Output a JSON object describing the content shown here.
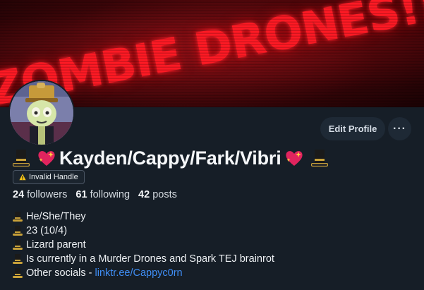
{
  "banner": {
    "text": "ZOMBIE DRONES!!!!!"
  },
  "profile": {
    "display_name": "Kayden/Cappy/Fark/Vibri",
    "handle_badge": "Invalid Handle",
    "edit_button_label": "Edit Profile",
    "more_button_label": "···"
  },
  "stats": {
    "followers_count": "24",
    "followers_label": "followers",
    "following_count": "61",
    "following_label": "following",
    "posts_count": "42",
    "posts_label": "posts"
  },
  "bio": {
    "lines": [
      "He/She/They",
      "23 (10/4)",
      "Lizard parent",
      "Is currently in a Murder Drones and Spark TEJ  brainrot"
    ],
    "socials_prefix": "Other socials - ",
    "socials_link": "linktr.ee/Cappyc0rn"
  },
  "colors": {
    "background": "#161e27",
    "banner_text": "#ff1a24",
    "link": "#3f8ef5",
    "button_bg": "#1e2935"
  },
  "icons": {
    "name_prefix": "top-hat-icon",
    "name_heart": "sparkling-heart-icon",
    "badge": "warning-icon",
    "bio_bullet": "top-hat-icon"
  }
}
